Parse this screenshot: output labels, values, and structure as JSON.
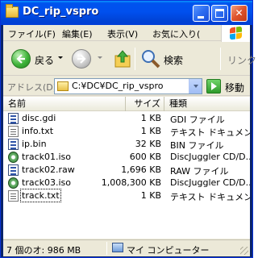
{
  "window": {
    "title": "DC_rip_vspro"
  },
  "menubar": {
    "items": [
      "ファイル(F)",
      "編集(E)",
      "表示(V)",
      "お気に入り("
    ]
  },
  "toolbar": {
    "back_label": "戻る",
    "search_label": "検索",
    "links_label": "リンク"
  },
  "addressbar": {
    "label": "アドレス(D)",
    "path": "C:¥DC¥DC_rip_vspro",
    "go_label": "移動"
  },
  "listview": {
    "columns": {
      "name": "名前",
      "size": "サイズ",
      "type": "種類"
    },
    "rows": [
      {
        "name": "disc.gdi",
        "size": "1 KB",
        "type": "GDI ファイル",
        "icon": "gdi-file-icon"
      },
      {
        "name": "info.txt",
        "size": "1 KB",
        "type": "テキスト ドキュメント",
        "icon": "text-file-icon"
      },
      {
        "name": "ip.bin",
        "size": "32 KB",
        "type": "BIN ファイル",
        "icon": "bin-file-icon"
      },
      {
        "name": "track01.iso",
        "size": "600 KB",
        "type": "DiscJuggler CD/D...",
        "icon": "disc-image-icon"
      },
      {
        "name": "track02.raw",
        "size": "1,696 KB",
        "type": "RAW ファイル",
        "icon": "raw-file-icon"
      },
      {
        "name": "track03.iso",
        "size": "1,008,300 KB",
        "type": "DiscJuggler CD/D...",
        "icon": "disc-image-icon"
      },
      {
        "name": "track.txt",
        "size": "1 KB",
        "type": "テキスト ドキュメント",
        "icon": "text-file-icon"
      }
    ]
  },
  "statusbar": {
    "summary": "7 個のオ: 986 MB",
    "location": "マイ コンピューター"
  },
  "colors": {
    "titlebar": "#0053ee",
    "close_button": "#e0532c",
    "window_bg": "#ece9d8"
  }
}
